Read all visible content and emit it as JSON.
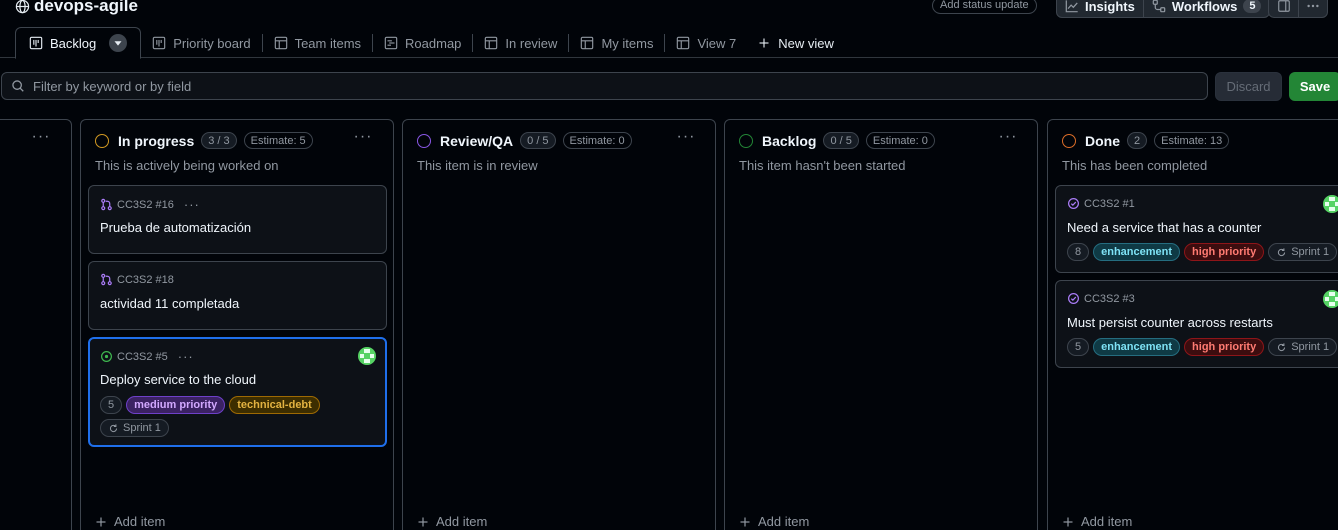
{
  "project": {
    "title": "devops-agile"
  },
  "header": {
    "status_update": "Add status update",
    "insights": "Insights",
    "workflows": "Workflows",
    "workflows_count": "5"
  },
  "tabs": [
    {
      "label": "Backlog",
      "icon": "board-icon",
      "active": true
    },
    {
      "label": "Priority board",
      "icon": "board-icon"
    },
    {
      "label": "Team items",
      "icon": "table-icon"
    },
    {
      "label": "Roadmap",
      "icon": "roadmap-icon"
    },
    {
      "label": "In review",
      "icon": "table-icon"
    },
    {
      "label": "My items",
      "icon": "table-icon"
    },
    {
      "label": "View 7",
      "icon": "table-icon"
    }
  ],
  "new_view": "New view",
  "filter": {
    "placeholder": "Filter by keyword or by field"
  },
  "actions": {
    "discard": "Discard",
    "save": "Save"
  },
  "add_item": "Add item",
  "columns": [
    {
      "name": "In progress",
      "count": "3 / 3",
      "estimate": "Estimate: 5",
      "description": "This is actively being worked on",
      "color": "#d29922",
      "cards": [
        {
          "ref": "CC3S2 #16",
          "title": "Prueba de automatización",
          "type": "pull-request"
        },
        {
          "ref": "CC3S2 #18",
          "title": "actividad 11 completada",
          "type": "pull-request"
        },
        {
          "ref": "CC3S2 #5",
          "title": "Deploy service to the cloud",
          "type": "open-issue",
          "estimate": "5",
          "labels": [
            "medium priority",
            "technical-debt"
          ],
          "sprint": "Sprint 1"
        }
      ]
    },
    {
      "name": "Review/QA",
      "count": "0 / 5",
      "estimate": "Estimate: 0",
      "description": "This item is in review",
      "color": "#8957e5",
      "cards": []
    },
    {
      "name": "Backlog",
      "count": "0 / 5",
      "estimate": "Estimate: 0",
      "description": "This item hasn't been started",
      "color": "#238636",
      "cards": []
    },
    {
      "name": "Done",
      "count": "2",
      "estimate": "Estimate: 13",
      "description": "This has been completed",
      "color": "#db6d28",
      "cards": [
        {
          "ref": "CC3S2 #1",
          "title": "Need a service that has a counter",
          "type": "closed-issue",
          "estimate": "8",
          "labels": [
            "enhancement",
            "high priority"
          ],
          "sprint": "Sprint 1"
        },
        {
          "ref": "CC3S2 #3",
          "title": "Must persist counter across restarts",
          "type": "closed-issue",
          "estimate": "5",
          "labels": [
            "enhancement",
            "high priority"
          ],
          "sprint": "Sprint 1"
        }
      ]
    }
  ],
  "colors": {
    "accent": "#1f6feb",
    "save": "#238636",
    "background": "#010409"
  }
}
